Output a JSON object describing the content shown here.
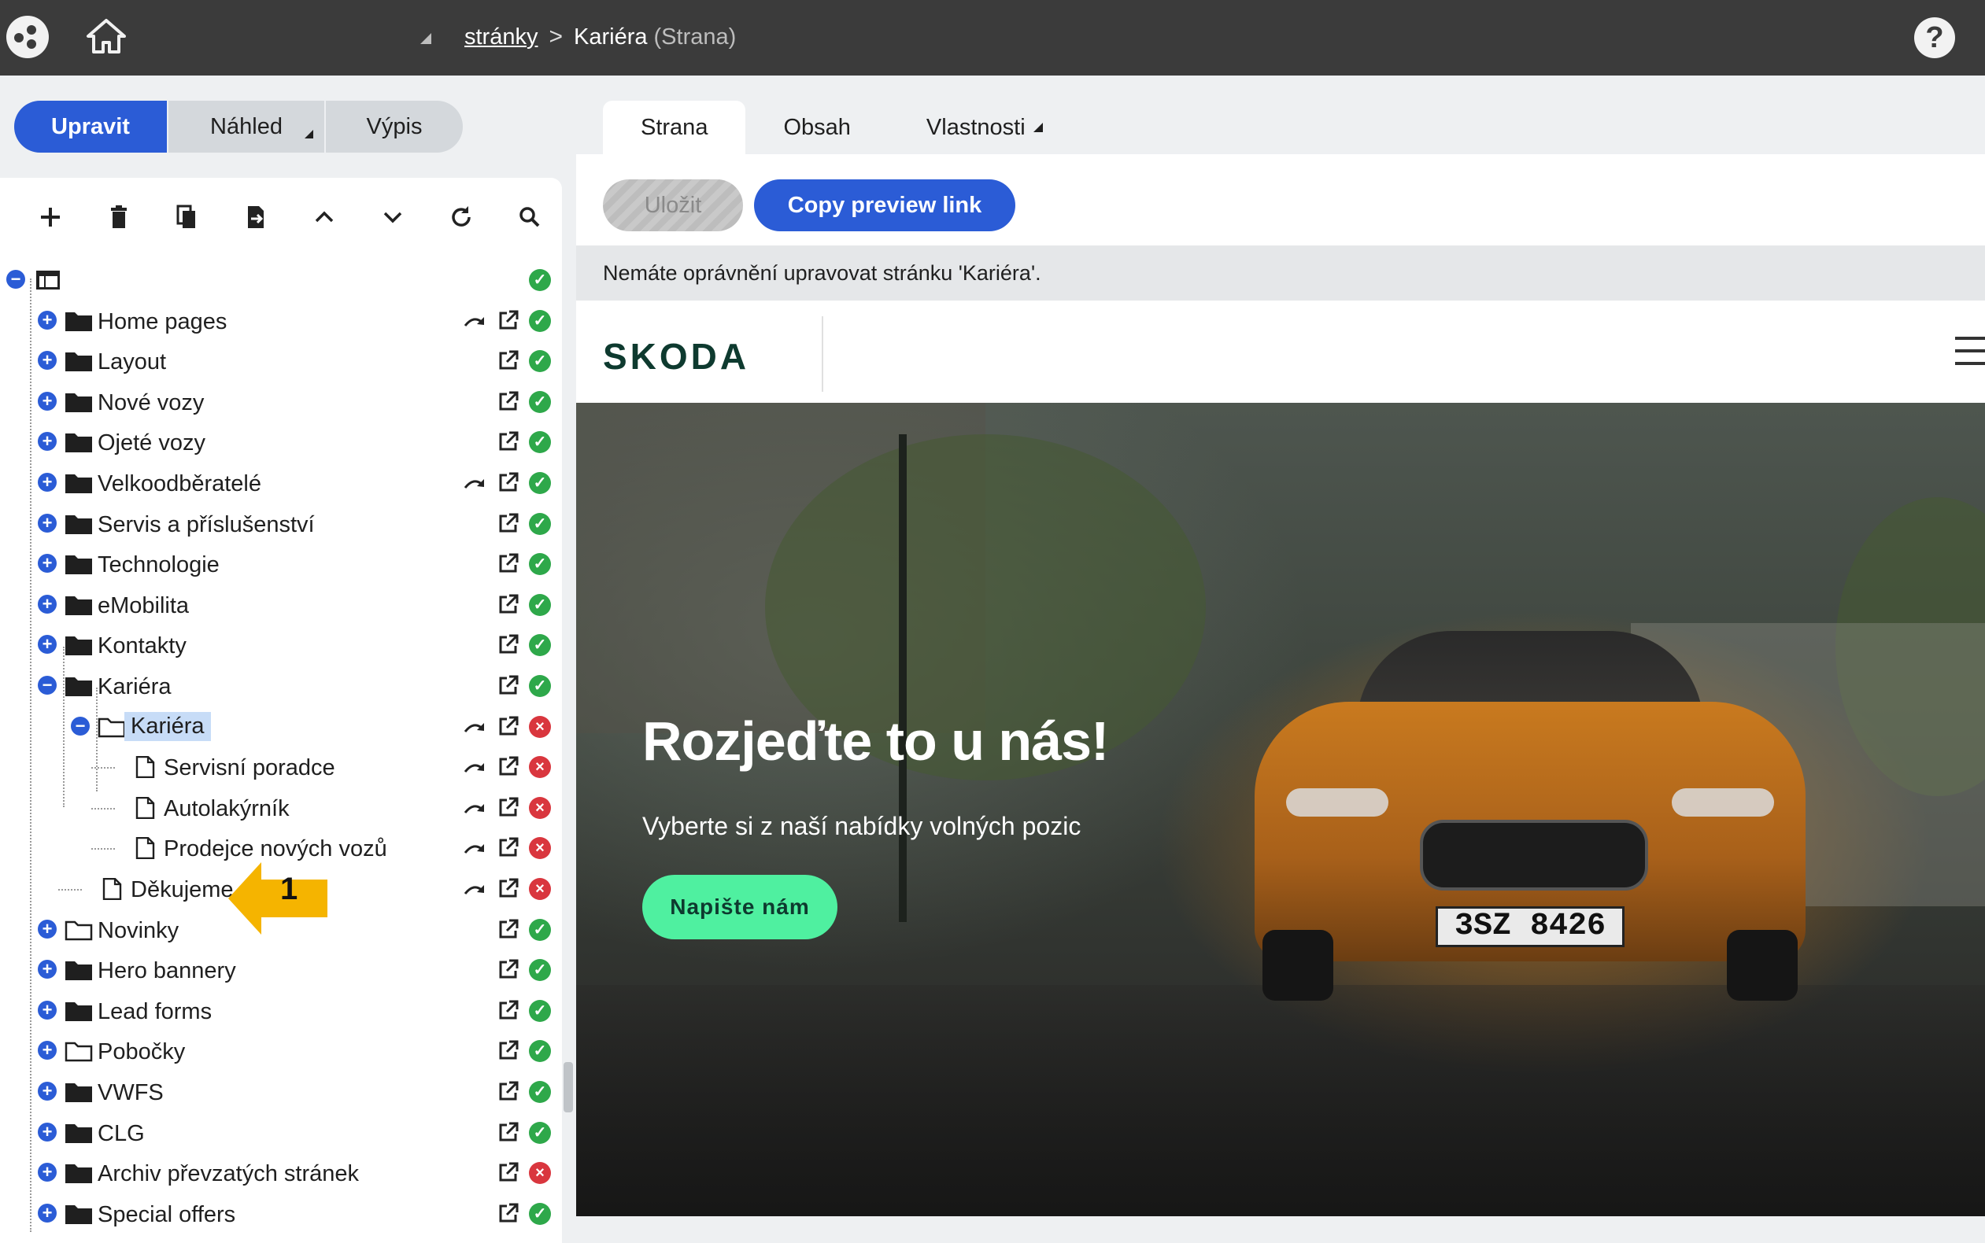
{
  "topbar": {
    "breadcrumb_link": "stránky",
    "breadcrumb_separator": ">",
    "breadcrumb_current": "Kariéra",
    "breadcrumb_type": "(Strana)",
    "help_label": "?"
  },
  "mode_buttons": [
    {
      "label": "Upravit",
      "active": true
    },
    {
      "label": "Náhled",
      "active": false
    },
    {
      "label": "Výpis",
      "active": false
    }
  ],
  "toolbar": [
    "add-icon",
    "trash-icon",
    "copy-icon",
    "export-icon",
    "chevron-up-icon",
    "chevron-down-icon",
    "refresh-icon",
    "search-icon"
  ],
  "tree": {
    "root_status": "ok",
    "items": [
      {
        "label": "Home pages",
        "level": 1,
        "expander": "+",
        "folder": "filled",
        "redirect": true,
        "status": "ok"
      },
      {
        "label": "Layout",
        "level": 1,
        "expander": "+",
        "folder": "filled",
        "redirect": false,
        "status": "ok"
      },
      {
        "label": "Nové vozy",
        "level": 1,
        "expander": "+",
        "folder": "filled",
        "redirect": false,
        "status": "ok"
      },
      {
        "label": "Ojeté vozy",
        "level": 1,
        "expander": "+",
        "folder": "filled",
        "redirect": false,
        "status": "ok"
      },
      {
        "label": "Velkoodběratelé",
        "level": 1,
        "expander": "+",
        "folder": "filled",
        "redirect": true,
        "status": "ok"
      },
      {
        "label": "Servis a příslušenství",
        "level": 1,
        "expander": "+",
        "folder": "filled",
        "redirect": false,
        "status": "ok"
      },
      {
        "label": "Technologie",
        "level": 1,
        "expander": "+",
        "folder": "filled",
        "redirect": false,
        "status": "ok"
      },
      {
        "label": "eMobilita",
        "level": 1,
        "expander": "+",
        "folder": "filled",
        "redirect": false,
        "status": "ok"
      },
      {
        "label": "Kontakty",
        "level": 1,
        "expander": "+",
        "folder": "filled",
        "redirect": false,
        "status": "ok"
      },
      {
        "label": "Kariéra",
        "level": 1,
        "expander": "-",
        "folder": "filled",
        "redirect": false,
        "status": "ok"
      },
      {
        "label": "Kariéra",
        "level": 2,
        "expander": "-",
        "folder": "outline",
        "redirect": true,
        "status": "err",
        "selected": true
      },
      {
        "label": "Servisní poradce",
        "level": 3,
        "expander": "",
        "folder": "page",
        "redirect": true,
        "status": "err"
      },
      {
        "label": "Autolakýrník",
        "level": 3,
        "expander": "",
        "folder": "page",
        "redirect": true,
        "status": "err"
      },
      {
        "label": "Prodejce nových vozů",
        "level": 3,
        "expander": "",
        "folder": "page",
        "redirect": true,
        "status": "err"
      },
      {
        "label": "Děkujeme",
        "level": 2,
        "expander": "",
        "folder": "page",
        "redirect": true,
        "status": "err"
      },
      {
        "label": "Novinky",
        "level": 1,
        "expander": "+",
        "folder": "outline",
        "redirect": false,
        "status": "ok"
      },
      {
        "label": "Hero bannery",
        "level": 1,
        "expander": "+",
        "folder": "filled",
        "redirect": false,
        "status": "ok"
      },
      {
        "label": "Lead forms",
        "level": 1,
        "expander": "+",
        "folder": "filled",
        "redirect": false,
        "status": "ok"
      },
      {
        "label": "Pobočky",
        "level": 1,
        "expander": "+",
        "folder": "outline",
        "redirect": false,
        "status": "ok"
      },
      {
        "label": "VWFS",
        "level": 1,
        "expander": "+",
        "folder": "filled",
        "redirect": false,
        "status": "ok"
      },
      {
        "label": "CLG",
        "level": 1,
        "expander": "+",
        "folder": "filled",
        "redirect": false,
        "status": "ok"
      },
      {
        "label": "Archiv převzatých stránek",
        "level": 1,
        "expander": "+",
        "folder": "filled",
        "redirect": false,
        "status": "err"
      },
      {
        "label": "Special offers",
        "level": 1,
        "expander": "+",
        "folder": "filled",
        "redirect": false,
        "status": "ok"
      }
    ]
  },
  "callout": {
    "number": "1",
    "color": "#f5b400"
  },
  "tabs": [
    {
      "label": "Strana",
      "active": true,
      "dropdown": false
    },
    {
      "label": "Obsah",
      "active": false,
      "dropdown": false
    },
    {
      "label": "Vlastnosti",
      "active": false,
      "dropdown": true
    }
  ],
  "editor": {
    "save_label": "Uložit",
    "preview_link_label": "Copy preview link",
    "notice": "Nemáte oprávnění upravovat stránku 'Kariéra'."
  },
  "preview": {
    "brand": "SKODA",
    "hero_title": "Rozjeďte to u nás!",
    "hero_subtitle": "Vyberte si z naší nabídky volných pozic",
    "cta_label": "Napište nám",
    "plate": "3SZ 8426"
  },
  "colors": {
    "accent": "#2b5cd6",
    "topbar": "#3b3b3b",
    "status_ok": "#2ea84a",
    "status_err": "#d9363e",
    "cta": "#4ff0a0",
    "brand": "#0e3a2f"
  }
}
